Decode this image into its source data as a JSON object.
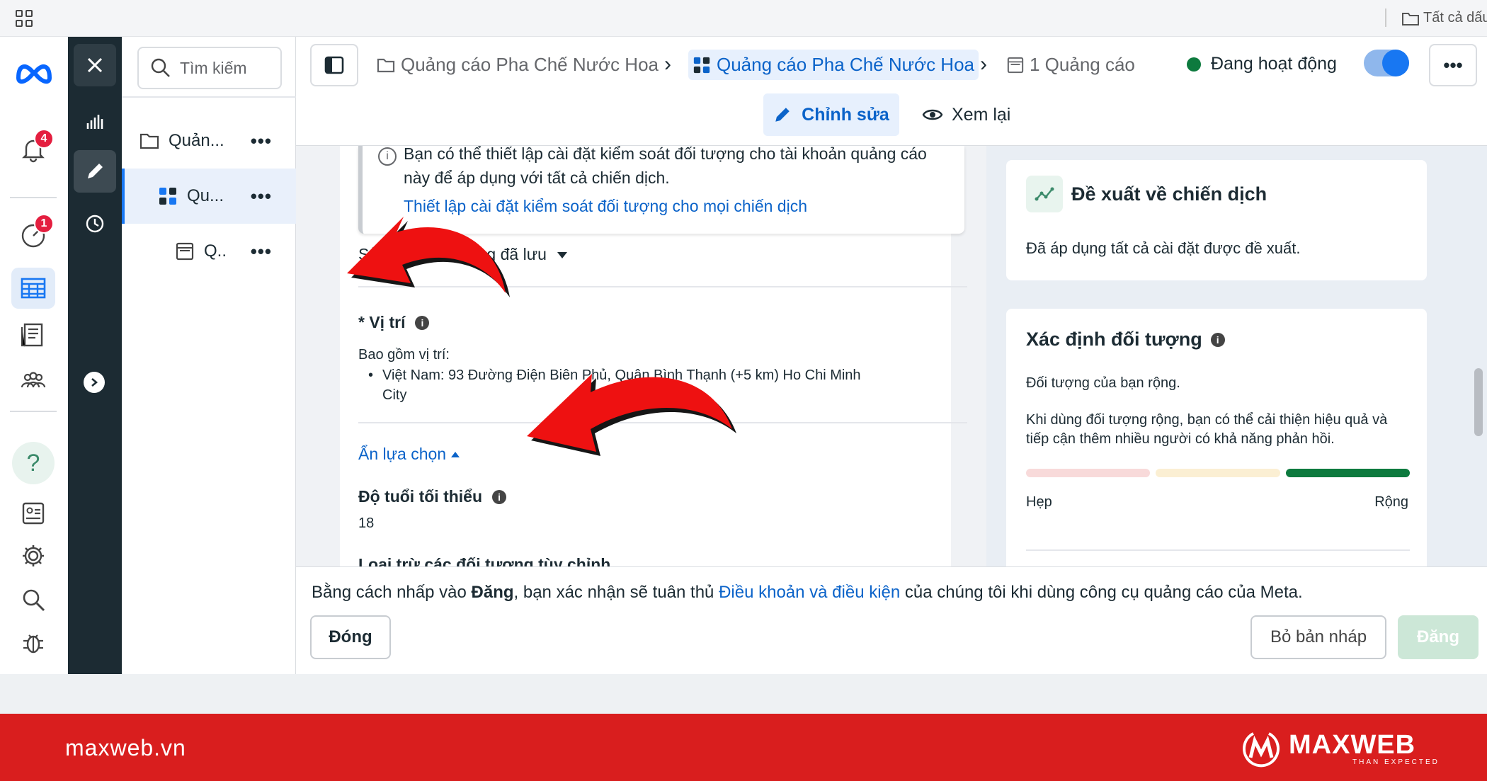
{
  "browser": {
    "all_folders": "Tất cả dấu"
  },
  "nav": {
    "notifications_badge": "4",
    "pages_badge": "1",
    "help_label": "?"
  },
  "tree": {
    "search_placeholder": "Tìm kiếm",
    "items": [
      {
        "label": "Quản...",
        "icon": "folder-icon"
      },
      {
        "label": "Qu...",
        "icon": "adset-grid-icon"
      },
      {
        "label": "Q..",
        "icon": "ad-icon"
      }
    ],
    "more": "•••"
  },
  "header": {
    "breadcrumb_campaign": "Quảng cáo Pha Chế Nước Hoa",
    "breadcrumb_adset": "Quảng cáo Pha Chế Nước Hoa",
    "breadcrumb_ads": "1 Quảng cáo",
    "status": "Đang hoạt động",
    "more": "•••",
    "tab_edit": "Chỉnh sửa",
    "tab_review": "Xem lại",
    "accent": "#1877f2"
  },
  "main": {
    "info_text": "Bạn có thể thiết lập cài đặt kiểm soát đối tượng cho tài khoản quảng cáo này để áp dụng với tất cả chiến dịch.",
    "info_link": "Thiết lập cài đặt kiểm soát đối tượng cho mọi chiến dịch",
    "saved_audience": "Sử dụng đối tượng đã lưu",
    "location_title": "* Vị trí",
    "location_sub": "Bao gồm vị trí:",
    "location_item": "Việt Nam: 93 Đường Điện Biên Phủ, Quận Bình Thạnh (+5 km) Ho Chi Minh City",
    "hide_options": "Ẩn lựa chọn",
    "age_title": "Độ tuổi tối thiểu",
    "age_value": "18",
    "cut_off_label": "Loại trừ các đối tượng tùy chỉnh"
  },
  "right": {
    "rec_title": "Đề xuất về chiến dịch",
    "rec_text": "Đã áp dụng tất cả cài đặt được đề xuất.",
    "aud_title": "Xác định đối tượng",
    "aud_status": "Đối tượng của bạn rộng.",
    "aud_desc": "Khi dùng đối tượng rộng, bạn có thể cải thiện hiệu quả và tiếp cận thêm nhiều người có khả năng phản hồi.",
    "narrow": "Hẹp",
    "broad": "Rộng",
    "meter_level": "broad",
    "meter_colors": [
      "#f8dada",
      "#fbefd3",
      "#0d7a3e"
    ]
  },
  "footer": {
    "terms_prefix": "Bằng cách nhấp vào ",
    "terms_bold": "Đăng",
    "terms_mid": ", bạn xác nhận sẽ tuân thủ ",
    "terms_link": "Điều khoản và điều kiện",
    "terms_suffix": " của chúng tôi khi dùng công cụ quảng cáo của Meta.",
    "close": "Đóng",
    "discard": "Bỏ bản nháp",
    "publish": "Đăng"
  },
  "brand": {
    "site": "maxweb.vn",
    "name": "MAXWEB",
    "tagline": "THAN EXPECTED"
  }
}
